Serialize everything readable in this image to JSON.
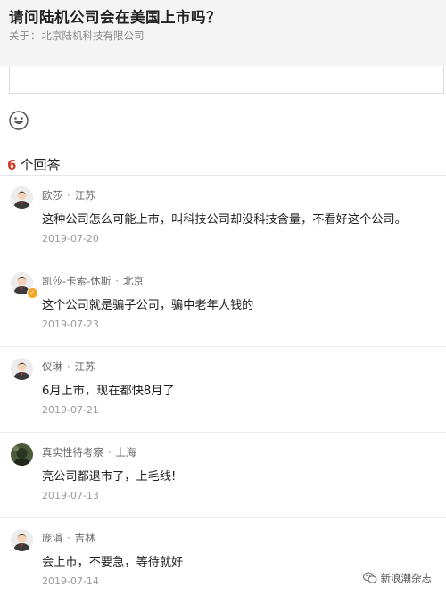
{
  "question": {
    "title": "请问陆机公司会在美国上市吗？",
    "about_prefix": "关于",
    "about_company": "北京陆机科技有限公司"
  },
  "answers_header": {
    "count": "6",
    "label": "个回答"
  },
  "answers": [
    {
      "name": "欧莎",
      "location": "江苏",
      "content": "这种公司怎么可能上市，叫科技公司却没科技含量，不看好这个公司。",
      "date": "2019-07-20",
      "avatar": "default-avatar"
    },
    {
      "name": "凯莎-卡索-休斯",
      "location": "北京",
      "content": "这个公司就是骗子公司，骗中老年人钱的",
      "date": "2019-07-23",
      "avatar": "default-avatar-verified"
    },
    {
      "name": "仪琳",
      "location": "江苏",
      "content": "6月上市，现在都快8月了",
      "date": "2019-07-21",
      "avatar": "default-avatar"
    },
    {
      "name": "真实性待考察",
      "location": "上海",
      "content": "亮公司都退市了，上毛线!",
      "date": "2019-07-13",
      "avatar": "photo-avatar"
    },
    {
      "name": "庞涓",
      "location": "吉林",
      "content": "会上市，不要急，等待就好",
      "date": "2019-07-14",
      "avatar": "default-avatar"
    }
  ],
  "watermark": {
    "text": "新浪潮杂志"
  }
}
